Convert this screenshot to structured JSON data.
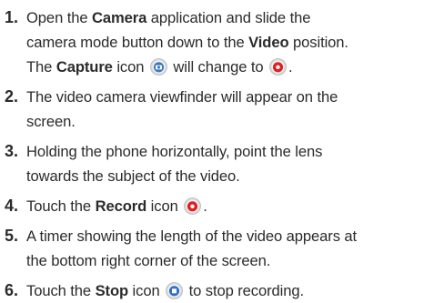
{
  "steps": [
    {
      "num": "1.",
      "lines": [
        [
          "Open the ",
          {
            "b": "Camera"
          },
          " application and slide the"
        ],
        [
          "camera mode button down to the ",
          {
            "b": "Video"
          },
          " position."
        ],
        [
          "The ",
          {
            "b": "Capture"
          },
          " icon ",
          {
            "icon": "capture-icon"
          },
          " will change to ",
          {
            "icon": "video-record-icon"
          },
          "."
        ]
      ]
    },
    {
      "num": "2.",
      "lines": [
        [
          "The video camera viewfinder will appear on the"
        ],
        [
          "screen."
        ]
      ]
    },
    {
      "num": "3.",
      "lines": [
        [
          "Holding the phone horizontally, point the lens"
        ],
        [
          "towards the subject of the video."
        ]
      ]
    },
    {
      "num": "4.",
      "lines": [
        [
          "Touch the ",
          {
            "b": "Record"
          },
          " icon ",
          {
            "icon": "record-icon"
          },
          "."
        ]
      ]
    },
    {
      "num": "5.",
      "lines": [
        [
          "A timer showing the length of the video appears at"
        ],
        [
          "the bottom right corner of the screen."
        ]
      ]
    },
    {
      "num": "6.",
      "lines": [
        [
          "Touch the ",
          {
            "b": "Stop"
          },
          " icon ",
          {
            "icon": "stop-icon"
          },
          " to stop recording."
        ]
      ]
    }
  ],
  "colors": {
    "text": "#2b2b2b",
    "icon_bezel": "#d8d8d8",
    "capture_blue": "#3a78c8",
    "record_red": "#e02020",
    "stop_blue": "#2f6fc4"
  }
}
